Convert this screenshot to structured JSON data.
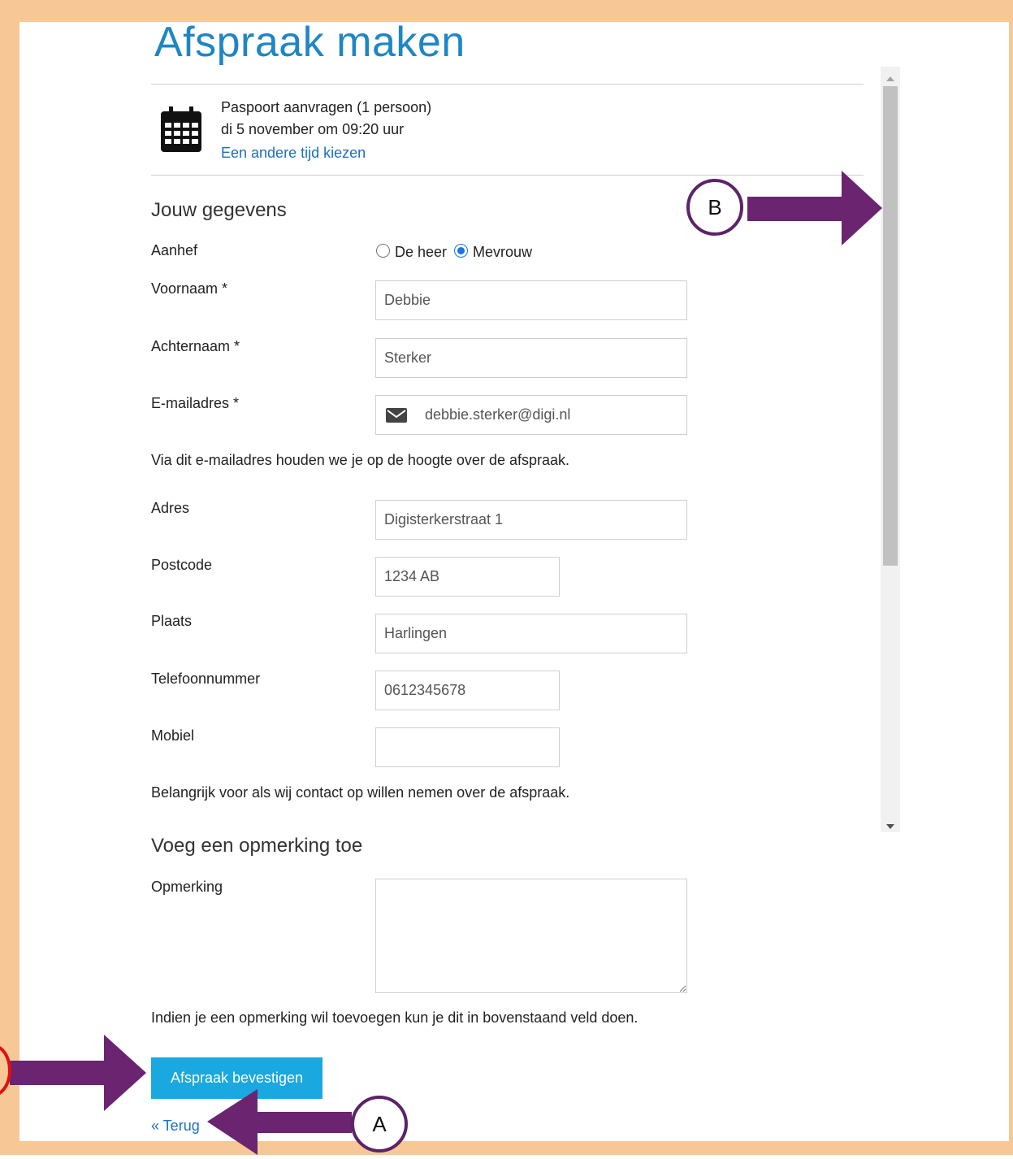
{
  "page": {
    "title": "Afspraak maken"
  },
  "appointment": {
    "service": "Paspoort aanvragen (1 persoon)",
    "datetime": "di 5 november om 09:20 uur",
    "change_link": "Een andere tijd kiezen"
  },
  "details": {
    "heading": "Jouw gegevens",
    "salutation": {
      "label": "Aanhef",
      "options": [
        "De heer",
        "Mevrouw"
      ],
      "selected": "Mevrouw"
    },
    "first_name": {
      "label": "Voornaam *",
      "value": "Debbie"
    },
    "last_name": {
      "label": "Achternaam *",
      "value": "Sterker"
    },
    "email": {
      "label": "E-mailadres *",
      "value": "debbie.sterker@digi.nl",
      "help": "Via dit e-mailadres houden we je op de hoogte over de afspraak."
    },
    "address": {
      "label": "Adres",
      "value": "Digisterkerstraat 1"
    },
    "postcode": {
      "label": "Postcode",
      "value": "1234 AB"
    },
    "city": {
      "label": "Plaats",
      "value": "Harlingen"
    },
    "phone": {
      "label": "Telefoonnummer",
      "value": "0612345678"
    },
    "mobile": {
      "label": "Mobiel",
      "value": "",
      "help": "Belangrijk voor als wij contact op willen nemen over de afspraak."
    }
  },
  "remark": {
    "heading": "Voeg een opmerking toe",
    "label": "Opmerking",
    "value": "",
    "help": "Indien je een opmerking wil toevoegen kun je dit in bovenstaand veld doen."
  },
  "actions": {
    "confirm": "Afspraak bevestigen",
    "back": "« Terug"
  },
  "annotations": {
    "a": "A",
    "b": "B"
  },
  "colors": {
    "frame": "#f7c896",
    "accent": "#1aa8e0",
    "title": "#1f86c4",
    "arrow": "#6a2470",
    "link": "#1a6fc4"
  }
}
